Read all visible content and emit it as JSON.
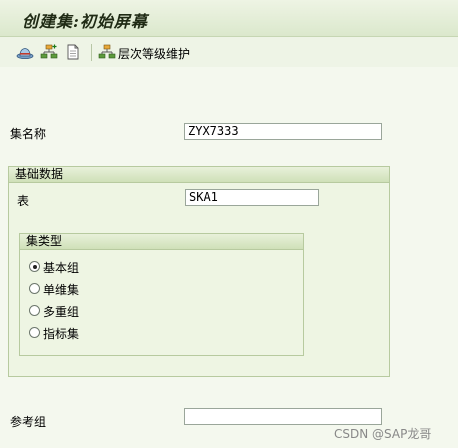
{
  "window": {
    "title": "创建集:初始屏幕"
  },
  "toolbar": {
    "icons": [
      "hat-icon",
      "hierarchy-add-icon",
      "document-icon",
      "hierarchy-icon"
    ],
    "hierarchy_button_label": "层次等级维护"
  },
  "form": {
    "set_name_label": "集名称",
    "set_name_value": "ZYX7333",
    "reference_group_label": "参考组",
    "reference_group_value": ""
  },
  "basic_data": {
    "title": "基础数据",
    "table_label": "表",
    "table_value": "SKA1",
    "set_type": {
      "title": "集类型",
      "options": [
        {
          "label": "基本组",
          "selected": true
        },
        {
          "label": "单维集",
          "selected": false
        },
        {
          "label": "多重组",
          "selected": false
        },
        {
          "label": "指标集",
          "selected": false
        }
      ]
    }
  },
  "watermark": "CSDN @SAP龙哥"
}
